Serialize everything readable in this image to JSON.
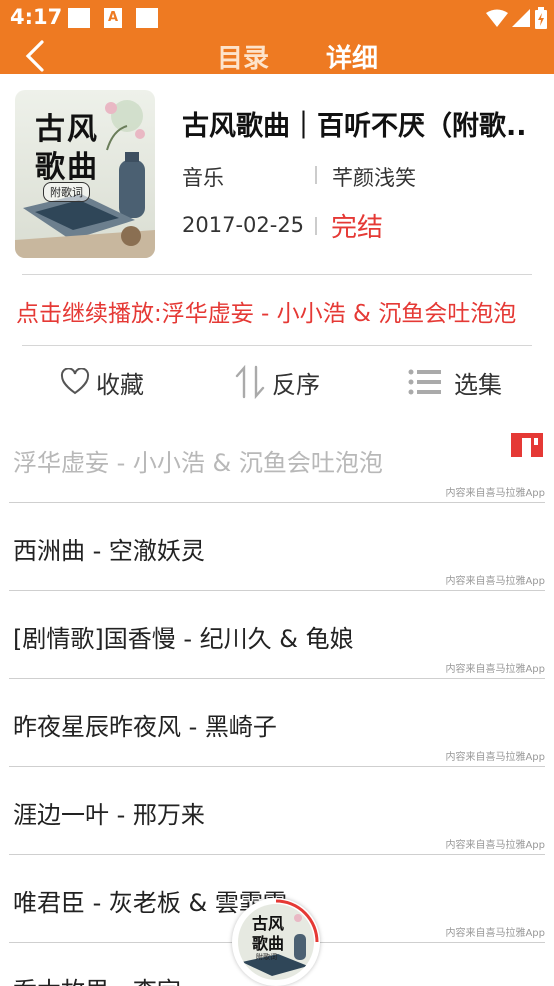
{
  "status_bar": {
    "time": "4:17"
  },
  "nav": {
    "tabs": [
      {
        "label": "目录"
      },
      {
        "label": "详细"
      }
    ]
  },
  "album": {
    "cover_text": {
      "line1": "古风",
      "line2": "歌曲",
      "line3": "附歌词"
    },
    "title": "古风歌曲｜百听不厌（附歌..",
    "category": "音乐",
    "author": "芊颜浅笑",
    "date": "2017-02-25",
    "state": "完结"
  },
  "continue_play": "点击继续播放:浮华虚妄 - 小小浩 & 沉鱼会吐泡泡",
  "actions": {
    "favorite": "收藏",
    "reverse": "反序",
    "select": "选集"
  },
  "episodes": [
    {
      "title": "浮华虚妄 - 小小浩 & 沉鱼会吐泡泡",
      "source": "内容来自喜马拉雅App"
    },
    {
      "title": "西洲曲 - 空澈妖灵",
      "source": "内容来自喜马拉雅App"
    },
    {
      "title": "[剧情歌]国香慢 - 纪川久 & 龟娘",
      "source": "内容来自喜马拉雅App"
    },
    {
      "title": "昨夜星辰昨夜风 - 黑崎子",
      "source": "内容来自喜马拉雅App"
    },
    {
      "title": "涯边一叶 - 邢万来",
      "source": "内容来自喜马拉雅App"
    },
    {
      "title": "唯君臣 - 灰老板 & 雲霏霏",
      "source": "内容来自喜马拉雅App"
    },
    {
      "title": "乔木故里 - 李宗一"
    }
  ],
  "colors": {
    "accent": "#ee7a22",
    "highlight": "#e53935"
  }
}
